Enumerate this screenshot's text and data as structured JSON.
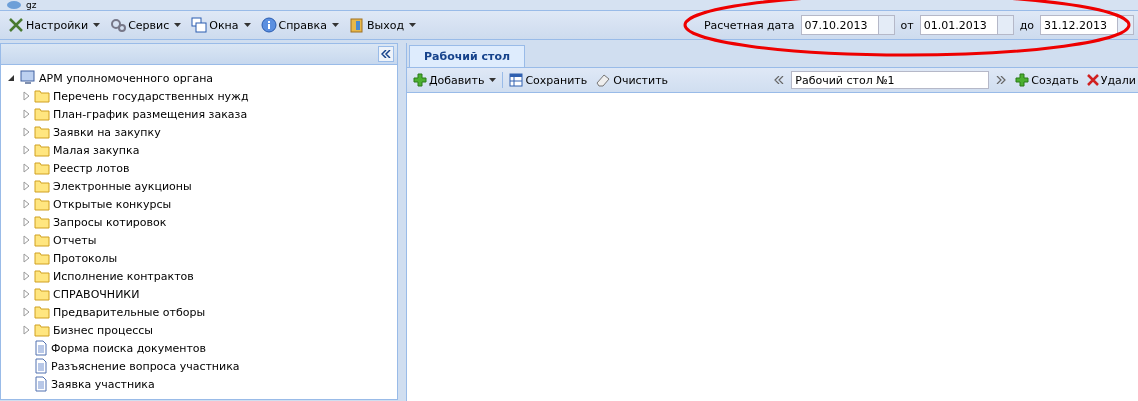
{
  "window": {
    "title": "gz"
  },
  "menu": [
    {
      "label": "Настройки"
    },
    {
      "label": "Сервис"
    },
    {
      "label": "Окна"
    },
    {
      "label": "Справка"
    },
    {
      "label": "Выход"
    }
  ],
  "date_filter": {
    "calc_label": "Расчетная дата",
    "calc_value": "07.10.2013",
    "from_label": "от",
    "from_value": "01.01.2013",
    "to_label": "до",
    "to_value": "31.12.2013",
    "highlighted": true
  },
  "tree": {
    "label": "АРМ уполномоченного органа",
    "expanded": true,
    "children": [
      {
        "kind": "folder",
        "label": "Перечень государственных нужд",
        "expanded": false
      },
      {
        "kind": "folder",
        "label": "План-график размещения заказа",
        "expanded": false
      },
      {
        "kind": "folder",
        "label": "Заявки на закупку",
        "expanded": false
      },
      {
        "kind": "folder",
        "label": "Малая закупка",
        "expanded": false
      },
      {
        "kind": "folder",
        "label": "Реестр лотов",
        "expanded": false
      },
      {
        "kind": "folder",
        "label": "Электронные аукционы",
        "expanded": false
      },
      {
        "kind": "folder",
        "label": "Открытые конкурсы",
        "expanded": false
      },
      {
        "kind": "folder",
        "label": "Запросы котировок",
        "expanded": false
      },
      {
        "kind": "folder",
        "label": "Отчеты",
        "expanded": false
      },
      {
        "kind": "folder",
        "label": "Протоколы",
        "expanded": false
      },
      {
        "kind": "folder",
        "label": "Исполнение контрактов",
        "expanded": false
      },
      {
        "kind": "folder",
        "label": "СПРАВОЧНИКИ",
        "expanded": false
      },
      {
        "kind": "folder",
        "label": "Предварительные отборы",
        "expanded": false
      },
      {
        "kind": "folder",
        "label": "Бизнес процессы",
        "expanded": false
      },
      {
        "kind": "document",
        "label": "Форма поиска документов"
      },
      {
        "kind": "document",
        "label": "Разъяснение вопроса участника"
      },
      {
        "kind": "document",
        "label": "Заявка участника"
      }
    ]
  },
  "tabs": [
    {
      "label": "Рабочий стол",
      "selected": true
    }
  ],
  "toolbar": {
    "add": "Добавить",
    "save": "Сохранить",
    "clear": "Очистить",
    "desktop_name": "Рабочий стол №1",
    "create": "Создать",
    "delete": "Удали"
  }
}
